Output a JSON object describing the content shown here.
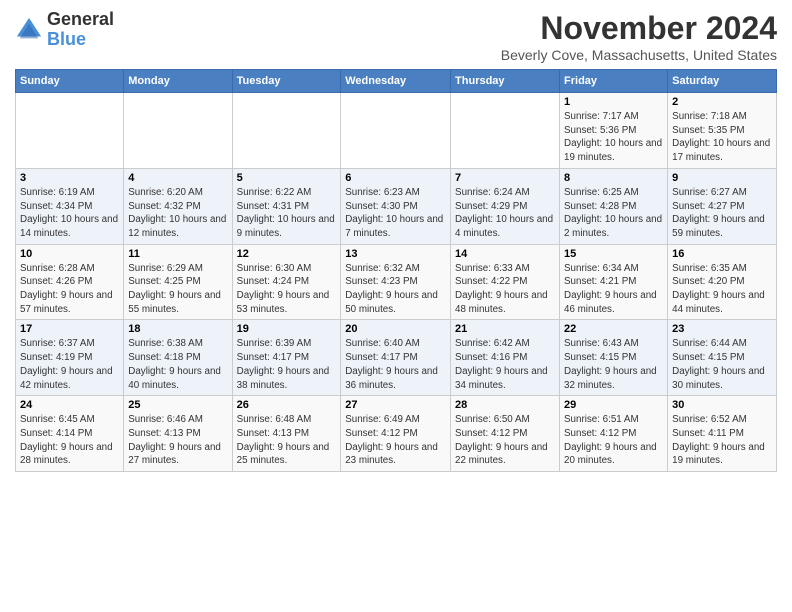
{
  "header": {
    "logo_line1": "General",
    "logo_line2": "Blue",
    "month": "November 2024",
    "location": "Beverly Cove, Massachusetts, United States"
  },
  "days_of_week": [
    "Sunday",
    "Monday",
    "Tuesday",
    "Wednesday",
    "Thursday",
    "Friday",
    "Saturday"
  ],
  "weeks": [
    [
      {
        "day": "",
        "info": ""
      },
      {
        "day": "",
        "info": ""
      },
      {
        "day": "",
        "info": ""
      },
      {
        "day": "",
        "info": ""
      },
      {
        "day": "",
        "info": ""
      },
      {
        "day": "1",
        "info": "Sunrise: 7:17 AM\nSunset: 5:36 PM\nDaylight: 10 hours and 19 minutes."
      },
      {
        "day": "2",
        "info": "Sunrise: 7:18 AM\nSunset: 5:35 PM\nDaylight: 10 hours and 17 minutes."
      }
    ],
    [
      {
        "day": "3",
        "info": "Sunrise: 6:19 AM\nSunset: 4:34 PM\nDaylight: 10 hours and 14 minutes."
      },
      {
        "day": "4",
        "info": "Sunrise: 6:20 AM\nSunset: 4:32 PM\nDaylight: 10 hours and 12 minutes."
      },
      {
        "day": "5",
        "info": "Sunrise: 6:22 AM\nSunset: 4:31 PM\nDaylight: 10 hours and 9 minutes."
      },
      {
        "day": "6",
        "info": "Sunrise: 6:23 AM\nSunset: 4:30 PM\nDaylight: 10 hours and 7 minutes."
      },
      {
        "day": "7",
        "info": "Sunrise: 6:24 AM\nSunset: 4:29 PM\nDaylight: 10 hours and 4 minutes."
      },
      {
        "day": "8",
        "info": "Sunrise: 6:25 AM\nSunset: 4:28 PM\nDaylight: 10 hours and 2 minutes."
      },
      {
        "day": "9",
        "info": "Sunrise: 6:27 AM\nSunset: 4:27 PM\nDaylight: 9 hours and 59 minutes."
      }
    ],
    [
      {
        "day": "10",
        "info": "Sunrise: 6:28 AM\nSunset: 4:26 PM\nDaylight: 9 hours and 57 minutes."
      },
      {
        "day": "11",
        "info": "Sunrise: 6:29 AM\nSunset: 4:25 PM\nDaylight: 9 hours and 55 minutes."
      },
      {
        "day": "12",
        "info": "Sunrise: 6:30 AM\nSunset: 4:24 PM\nDaylight: 9 hours and 53 minutes."
      },
      {
        "day": "13",
        "info": "Sunrise: 6:32 AM\nSunset: 4:23 PM\nDaylight: 9 hours and 50 minutes."
      },
      {
        "day": "14",
        "info": "Sunrise: 6:33 AM\nSunset: 4:22 PM\nDaylight: 9 hours and 48 minutes."
      },
      {
        "day": "15",
        "info": "Sunrise: 6:34 AM\nSunset: 4:21 PM\nDaylight: 9 hours and 46 minutes."
      },
      {
        "day": "16",
        "info": "Sunrise: 6:35 AM\nSunset: 4:20 PM\nDaylight: 9 hours and 44 minutes."
      }
    ],
    [
      {
        "day": "17",
        "info": "Sunrise: 6:37 AM\nSunset: 4:19 PM\nDaylight: 9 hours and 42 minutes."
      },
      {
        "day": "18",
        "info": "Sunrise: 6:38 AM\nSunset: 4:18 PM\nDaylight: 9 hours and 40 minutes."
      },
      {
        "day": "19",
        "info": "Sunrise: 6:39 AM\nSunset: 4:17 PM\nDaylight: 9 hours and 38 minutes."
      },
      {
        "day": "20",
        "info": "Sunrise: 6:40 AM\nSunset: 4:17 PM\nDaylight: 9 hours and 36 minutes."
      },
      {
        "day": "21",
        "info": "Sunrise: 6:42 AM\nSunset: 4:16 PM\nDaylight: 9 hours and 34 minutes."
      },
      {
        "day": "22",
        "info": "Sunrise: 6:43 AM\nSunset: 4:15 PM\nDaylight: 9 hours and 32 minutes."
      },
      {
        "day": "23",
        "info": "Sunrise: 6:44 AM\nSunset: 4:15 PM\nDaylight: 9 hours and 30 minutes."
      }
    ],
    [
      {
        "day": "24",
        "info": "Sunrise: 6:45 AM\nSunset: 4:14 PM\nDaylight: 9 hours and 28 minutes."
      },
      {
        "day": "25",
        "info": "Sunrise: 6:46 AM\nSunset: 4:13 PM\nDaylight: 9 hours and 27 minutes."
      },
      {
        "day": "26",
        "info": "Sunrise: 6:48 AM\nSunset: 4:13 PM\nDaylight: 9 hours and 25 minutes."
      },
      {
        "day": "27",
        "info": "Sunrise: 6:49 AM\nSunset: 4:12 PM\nDaylight: 9 hours and 23 minutes."
      },
      {
        "day": "28",
        "info": "Sunrise: 6:50 AM\nSunset: 4:12 PM\nDaylight: 9 hours and 22 minutes."
      },
      {
        "day": "29",
        "info": "Sunrise: 6:51 AM\nSunset: 4:12 PM\nDaylight: 9 hours and 20 minutes."
      },
      {
        "day": "30",
        "info": "Sunrise: 6:52 AM\nSunset: 4:11 PM\nDaylight: 9 hours and 19 minutes."
      }
    ]
  ]
}
